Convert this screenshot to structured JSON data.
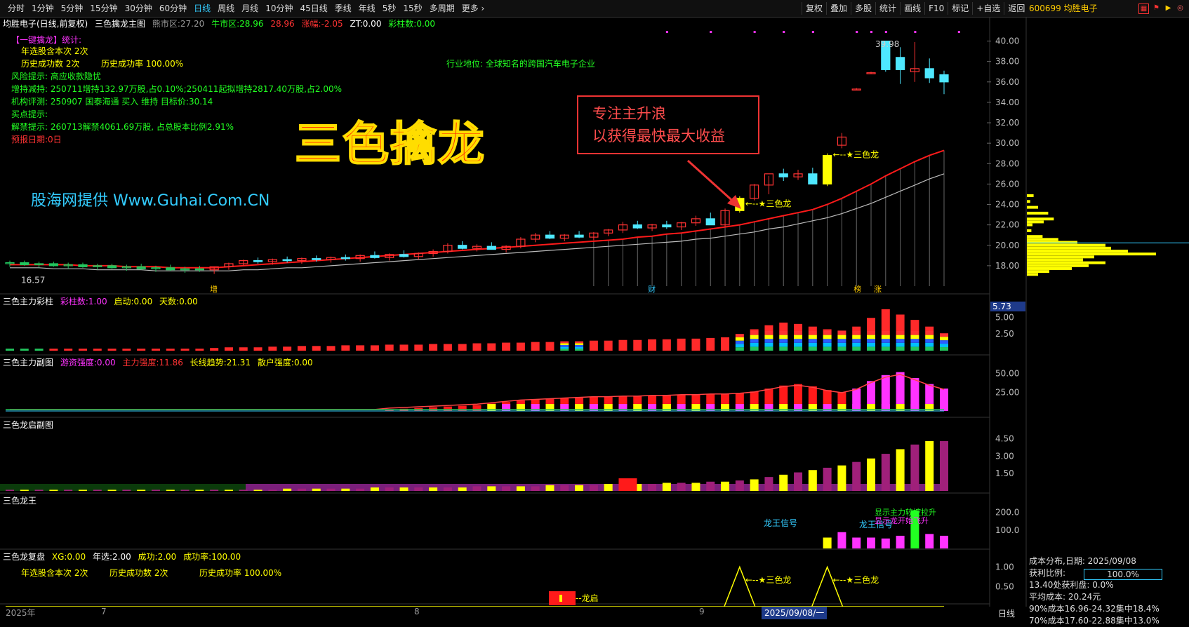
{
  "toolbar": {
    "periods": [
      "分时",
      "1分钟",
      "5分钟",
      "15分钟",
      "30分钟",
      "60分钟",
      "日线",
      "周线",
      "月线",
      "10分钟",
      "45日线",
      "季线",
      "年线",
      "5秒",
      "15秒",
      "多周期",
      "更多 ›"
    ],
    "active_period": "日线",
    "tools": [
      "复权",
      "叠加",
      "多股",
      "统计",
      "画线",
      "F10",
      "标记",
      "+自选",
      "返回"
    ],
    "stock": "600699 均胜电子"
  },
  "main_info": {
    "name": "均胜电子(日线,前复权)",
    "indicator": "三色擒龙主图",
    "pe_label": "熊市区:",
    "pe_value": "27.20",
    "bull_label": "牛市区:",
    "bull_value": "28.96",
    "val3": "28.96",
    "chg_label": "涨幅:",
    "chg_value": "-2.05",
    "zt_label": "ZT:",
    "zt_value": "0.00",
    "cz_label": "彩柱数:",
    "cz_value": "0.00"
  },
  "overlay": {
    "stats_header": "【一键擒龙】统计:",
    "line1": "年选股含本次 2次",
    "line2a": "历史成功数 2次",
    "line2b": "历史成功率 100.00%",
    "risk": "风险提示: 高应收款隐忧",
    "holdings": "增持减持: 250711增持132.97万股,占0.10%;250411起拟增持2817.40万股,占2.00%",
    "rating": "机构评测: 250907 国泰海通 买入 维持 目标价:30.14",
    "buy": "买点提示:",
    "unlock": "解禁提示: 260713解禁4061.69万股, 占总股本比例2.91%",
    "report": "预报日期:0日",
    "industry": "行业地位: 全球知名的跨国汽车电子企业",
    "watermark": "股海网提供 Www.Guhai.Com.CN",
    "big_title": "三色擒龙",
    "callout_line1": "专注主升浪",
    "callout_line2": "以获得最快最大收益",
    "signal1": "←--★三色龙",
    "signal2": "←--★三色龙",
    "high_label": "39.98",
    "low_label": "16.57",
    "marker_zeng": "增",
    "marker_cai": "财",
    "marker_bang": "榜",
    "marker_zhang": "涨"
  },
  "panels": [
    {
      "title": "三色主力彩柱",
      "k1": "彩柱数:",
      "v1": "1.00",
      "k2": "启动:",
      "v2": "0.00",
      "k3": "天数:",
      "v3": "0.00"
    },
    {
      "title": "三色主力副图",
      "k1": "游资强度:",
      "v1": "0.00",
      "k2": "主力强度:",
      "v2": "11.86",
      "k3": "长线趋势:",
      "v3": "21.31",
      "k4": "散户强度:",
      "v4": "0.00"
    },
    {
      "title": "三色龙启副图"
    },
    {
      "title": "三色龙王",
      "sig1": "龙王信号",
      "sig2": "龙王信号",
      "sig3": "显示主力较控拉升",
      "sig4": "显示龙开始飞升"
    },
    {
      "title": "三色龙复盘",
      "k1": "XG:",
      "v1": "0.00",
      "k2": "年选:",
      "v2": "2.00",
      "k3": "成功:",
      "v3": "2.00",
      "k4": "成功率:",
      "v4": "100.00",
      "line_a": "年选股含本次 2次",
      "line_b": "历史成功数 2次",
      "line_c": "历史成功率 100.00%",
      "sig_a": "←--★三色龙",
      "sig_b": "←--★三色龙",
      "sig_c": "--龙启"
    }
  ],
  "price_axis": [
    "40.00",
    "38.00",
    "36.00",
    "34.00",
    "32.00",
    "30.00",
    "28.00",
    "26.00",
    "24.00",
    "22.00",
    "20.00",
    "18.00"
  ],
  "panel1_axis": [
    "5.00",
    "2.50"
  ],
  "panel1_cursor": "5.73",
  "panel2_axis": [
    "50.00",
    "25.00"
  ],
  "panel3_axis": [
    "4.50",
    "3.00",
    "1.50"
  ],
  "panel4_axis": [
    "200.0",
    "100.0"
  ],
  "panel5_axis": [
    "1.00",
    "0.50"
  ],
  "x_axis": [
    "2025年",
    "7",
    "8",
    "9"
  ],
  "date_cursor": "2025/09/08/一",
  "day_label": "日线",
  "cost": {
    "title": "成本分布,日期: 2025/09/08",
    "ratio_label": "获利比例:",
    "ratio_value": "100.0%",
    "line1": "13.40处获利盘: 0.0%",
    "line2": "平均成本: 20.24元",
    "line3": "90%成本16.96-24.32集中18.4%",
    "line4": "70%成本17.60-22.88集中13.0%"
  },
  "colors": {
    "up": "#ff3333",
    "down": "#4ee8ff",
    "ma": "#ff1a1a",
    "ma2": "#bbbbbb",
    "yellow": "#ffff00",
    "magenta": "#ff33ff"
  },
  "chart_data": {
    "type": "candlestick",
    "title": "均胜电子(日线,前复权)",
    "ylim": [
      16,
      41
    ],
    "candles": [
      [
        18.2,
        18.5,
        17.9,
        18.3
      ],
      [
        18.3,
        18.5,
        18.0,
        18.1
      ],
      [
        18.1,
        18.4,
        17.8,
        18.2
      ],
      [
        18.2,
        18.4,
        17.9,
        18.0
      ],
      [
        18.0,
        18.3,
        17.7,
        18.1
      ],
      [
        18.1,
        18.3,
        17.8,
        17.9
      ],
      [
        17.9,
        18.2,
        17.6,
        18.0
      ],
      [
        18.0,
        18.2,
        17.7,
        17.8
      ],
      [
        17.8,
        18.1,
        17.5,
        17.9
      ],
      [
        17.9,
        18.2,
        17.6,
        17.7
      ],
      [
        17.7,
        18.0,
        17.4,
        17.8
      ],
      [
        17.8,
        18.1,
        17.5,
        17.6
      ],
      [
        17.6,
        17.9,
        17.3,
        17.7
      ],
      [
        17.7,
        18.0,
        17.4,
        17.6
      ],
      [
        17.6,
        17.9,
        17.2,
        17.9
      ],
      [
        17.9,
        18.3,
        17.6,
        18.2
      ],
      [
        18.2,
        18.6,
        18.0,
        18.5
      ],
      [
        18.5,
        18.8,
        18.2,
        18.4
      ],
      [
        18.4,
        18.7,
        18.1,
        18.6
      ],
      [
        18.6,
        18.9,
        18.3,
        18.5
      ],
      [
        18.5,
        18.8,
        18.2,
        18.7
      ],
      [
        18.7,
        19.0,
        18.4,
        18.6
      ],
      [
        18.6,
        18.9,
        18.3,
        18.8
      ],
      [
        18.8,
        19.1,
        18.5,
        18.7
      ],
      [
        18.7,
        19.1,
        18.4,
        19.0
      ],
      [
        19.0,
        19.4,
        18.7,
        18.8
      ],
      [
        18.8,
        19.2,
        18.5,
        19.1
      ],
      [
        19.1,
        19.5,
        18.8,
        18.9
      ],
      [
        18.9,
        19.3,
        18.6,
        19.2
      ],
      [
        19.2,
        19.6,
        18.9,
        19.4
      ],
      [
        19.4,
        20.2,
        19.2,
        20.0
      ],
      [
        20.0,
        20.4,
        19.6,
        19.7
      ],
      [
        19.7,
        20.1,
        19.4,
        19.9
      ],
      [
        19.9,
        20.3,
        19.6,
        19.6
      ],
      [
        19.6,
        20.0,
        19.3,
        19.9
      ],
      [
        19.9,
        20.8,
        19.7,
        20.6
      ],
      [
        20.6,
        21.2,
        20.3,
        21.0
      ],
      [
        21.0,
        21.4,
        20.6,
        20.7
      ],
      [
        20.7,
        21.1,
        20.4,
        21.0
      ],
      [
        21.0,
        21.4,
        20.7,
        20.8
      ],
      [
        20.8,
        21.3,
        20.5,
        21.2
      ],
      [
        21.2,
        21.6,
        20.9,
        21.5
      ],
      [
        21.5,
        22.3,
        21.2,
        22.0
      ],
      [
        22.0,
        22.4,
        21.6,
        21.7
      ],
      [
        21.7,
        22.1,
        21.4,
        22.0
      ],
      [
        22.0,
        22.4,
        21.6,
        21.8
      ],
      [
        21.8,
        22.3,
        21.5,
        22.2
      ],
      [
        22.2,
        22.9,
        21.9,
        22.6
      ],
      [
        22.6,
        23.2,
        22.3,
        22.0
      ],
      [
        22.0,
        23.6,
        21.8,
        23.4
      ],
      [
        23.4,
        24.8,
        23.2,
        24.6
      ],
      [
        24.6,
        26.0,
        24.4,
        25.9
      ],
      [
        25.9,
        26.8,
        25.0,
        27.0
      ],
      [
        27.0,
        27.5,
        26.3,
        26.7
      ],
      [
        26.7,
        27.4,
        26.4,
        27.0
      ],
      [
        27.0,
        27.6,
        26.2,
        26.0
      ],
      [
        26.0,
        29.0,
        25.8,
        28.8
      ],
      [
        29.8,
        31.0,
        29.5,
        30.6
      ],
      [
        35.2,
        35.4,
        35.2,
        35.3
      ],
      [
        36.8,
        37.0,
        36.8,
        36.9
      ],
      [
        40.0,
        40.0,
        37.0,
        37.2
      ],
      [
        38.4,
        39.4,
        35.8,
        37.2
      ],
      [
        37.0,
        39.9,
        36.0,
        37.3
      ],
      [
        37.3,
        38.3,
        35.9,
        36.4
      ],
      [
        36.7,
        37.1,
        34.8,
        36.0
      ]
    ],
    "ma_red": [
      18.1,
      18.1,
      18.1,
      18.1,
      18.1,
      18.0,
      18.0,
      18.0,
      17.9,
      17.9,
      17.9,
      17.8,
      17.8,
      17.8,
      17.8,
      17.9,
      18.0,
      18.1,
      18.2,
      18.3,
      18.4,
      18.5,
      18.6,
      18.7,
      18.8,
      18.9,
      19.0,
      19.1,
      19.2,
      19.3,
      19.4,
      19.5,
      19.6,
      19.7,
      19.8,
      19.9,
      20.0,
      20.1,
      20.2,
      20.3,
      20.4,
      20.5,
      20.6,
      20.8,
      20.9,
      21.1,
      21.2,
      21.4,
      21.6,
      21.8,
      22.0,
      22.3,
      22.6,
      22.9,
      23.2,
      23.5,
      24.0,
      24.6,
      25.3,
      26.0,
      26.8,
      27.5,
      28.2,
      28.8,
      29.3
    ],
    "ma_gray": [
      17.8,
      17.8,
      17.8,
      17.7,
      17.7,
      17.7,
      17.6,
      17.6,
      17.6,
      17.6,
      17.5,
      17.5,
      17.5,
      17.5,
      17.5,
      17.5,
      17.6,
      17.6,
      17.7,
      17.8,
      17.8,
      17.9,
      18.0,
      18.1,
      18.2,
      18.3,
      18.4,
      18.5,
      18.6,
      18.7,
      18.8,
      18.9,
      19.0,
      19.1,
      19.2,
      19.3,
      19.4,
      19.5,
      19.6,
      19.7,
      19.8,
      19.9,
      20.0,
      20.1,
      20.2,
      20.3,
      20.4,
      20.6,
      20.7,
      20.9,
      21.1,
      21.3,
      21.6,
      21.8,
      22.1,
      22.4,
      22.7,
      23.1,
      23.6,
      24.1,
      24.7,
      25.3,
      25.9,
      26.5,
      27.0
    ],
    "panel1_values": [
      0.3,
      0.3,
      0.3,
      0.3,
      0.3,
      0.3,
      0.3,
      0.3,
      0.3,
      0.3,
      0.3,
      0.3,
      0.3,
      0.3,
      0.4,
      0.5,
      0.5,
      0.5,
      0.6,
      0.6,
      0.7,
      0.7,
      0.7,
      0.8,
      0.8,
      0.8,
      0.9,
      0.9,
      0.9,
      1.0,
      1.0,
      1.0,
      1.1,
      1.1,
      1.2,
      1.2,
      1.3,
      1.3,
      1.4,
      1.4,
      1.5,
      1.5,
      1.6,
      1.6,
      1.7,
      1.7,
      1.8,
      1.8,
      1.9,
      2.0,
      2.5,
      3.2,
      3.8,
      4.2,
      4.0,
      3.6,
      3.2,
      3.0,
      3.6,
      4.9,
      6.2,
      5.4,
      4.6,
      3.6,
      2.6
    ],
    "panel2_values": [
      0,
      0,
      0,
      0,
      0,
      0,
      0,
      0,
      0,
      0,
      0,
      0,
      0,
      0,
      0,
      0,
      0,
      0,
      0,
      0,
      0,
      0,
      0,
      0,
      0,
      0,
      2,
      3,
      4,
      5,
      6,
      7,
      8,
      10,
      12,
      14,
      15,
      16,
      17,
      18,
      19,
      19,
      20,
      20,
      21,
      21,
      22,
      22,
      23,
      23,
      24,
      26,
      30,
      34,
      36,
      33,
      28,
      25,
      30,
      40,
      48,
      52,
      44,
      36,
      30
    ],
    "panel3_values": [
      0.1,
      0.1,
      0.1,
      0.1,
      0.1,
      0.1,
      0.1,
      0.1,
      0.1,
      0.1,
      0.1,
      0.1,
      0.1,
      0.1,
      0.1,
      0.1,
      0.1,
      0.1,
      0.1,
      0.2,
      0.2,
      0.2,
      0.2,
      0.2,
      0.2,
      0.3,
      0.3,
      0.3,
      0.3,
      0.3,
      0.3,
      0.3,
      0.4,
      0.4,
      0.4,
      0.4,
      0.4,
      0.5,
      0.5,
      0.5,
      0.5,
      0.6,
      0.6,
      0.6,
      0.6,
      0.7,
      0.7,
      0.7,
      0.8,
      0.8,
      0.9,
      1.0,
      1.2,
      1.4,
      1.6,
      1.8,
      2.0,
      2.2,
      2.5,
      2.8,
      3.2,
      3.6,
      4.0,
      4.3,
      4.3
    ],
    "panel4_values": [
      0,
      0,
      0,
      0,
      0,
      0,
      0,
      0,
      0,
      0,
      0,
      0,
      0,
      0,
      0,
      0,
      0,
      0,
      0,
      0,
      0,
      0,
      0,
      0,
      0,
      0,
      0,
      0,
      0,
      0,
      0,
      0,
      0,
      0,
      0,
      0,
      0,
      0,
      0,
      0,
      0,
      0,
      0,
      0,
      0,
      0,
      0,
      0,
      0,
      0,
      0,
      0,
      0,
      0,
      0,
      0,
      60,
      90,
      60,
      60,
      55,
      70,
      210,
      80,
      70
    ]
  }
}
